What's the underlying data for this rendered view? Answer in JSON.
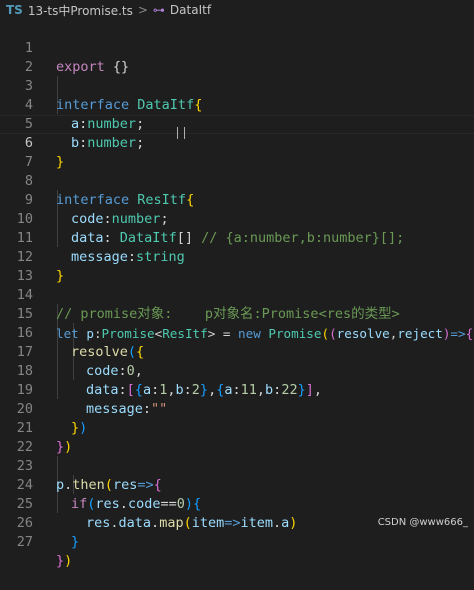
{
  "breadcrumb": {
    "file_badge": "TS",
    "file_name": "13-ts中Promise.ts",
    "separator": ">",
    "symbol_icon": "interface-symbol-icon",
    "symbol_name": "DataItf"
  },
  "editor": {
    "active_line": "6",
    "lines": [
      {
        "num": "1"
      },
      {
        "num": "2"
      },
      {
        "num": "3"
      },
      {
        "num": "4"
      },
      {
        "num": "5"
      },
      {
        "num": "6"
      },
      {
        "num": "7"
      },
      {
        "num": "8"
      },
      {
        "num": "9"
      },
      {
        "num": "10"
      },
      {
        "num": "11"
      },
      {
        "num": "12"
      },
      {
        "num": "13"
      },
      {
        "num": "14"
      },
      {
        "num": "15"
      },
      {
        "num": "16"
      },
      {
        "num": "17"
      },
      {
        "num": "18"
      },
      {
        "num": "19"
      },
      {
        "num": "20"
      },
      {
        "num": "21"
      },
      {
        "num": "22"
      },
      {
        "num": "23"
      },
      {
        "num": "24"
      },
      {
        "num": "25"
      },
      {
        "num": "26"
      },
      {
        "num": "27"
      }
    ],
    "tokens": {
      "export": "export",
      "export_braces": " {}",
      "interface": "interface",
      "DataItf": "DataItf",
      "brace_open": "{",
      "brace_close": "}",
      "a": "a",
      "colon": ":",
      "number": "number",
      "semi": ";",
      "b": "b",
      "ResItf": "ResItf",
      "code": "code",
      "data": "data",
      "DataItf_arr": "DataItf",
      "arr_brackets": "[]",
      "comment_line9": "// {a:number,b:number}[];",
      "message": "message",
      "string": "string",
      "comment_line14": "// promise对象:    p对象名:Promise<res的类型>",
      "let": "let",
      "p": "p",
      "Promise": "Promise",
      "lt": "<",
      "gt": ">",
      "eq": " = ",
      "new": "new",
      "Promise2": "Promise",
      "lp": "(",
      "resolve": "resolve",
      "comma": ",",
      "reject": "reject",
      "rp": ")",
      "arrow": "=>",
      "resolve_call": "resolve",
      "code_key": "code",
      "zero": "0",
      "data_key": "data",
      "a_key": "a",
      "one": "1",
      "b_key": "b",
      "two": "2",
      "eleven": "11",
      "twentytwo": "22",
      "message_key": "message",
      "empty_str": "\"\"",
      "then": "then",
      "res": "res",
      "if": "if",
      "dot": ".",
      "eqeq": "==",
      "map": "map",
      "item": "item"
    }
  },
  "watermark": "CSDN @www666_"
}
